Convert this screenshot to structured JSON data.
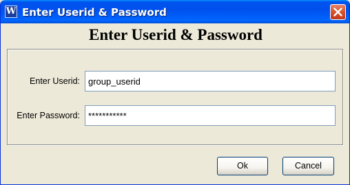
{
  "window": {
    "title": "Enter Userid & Password",
    "icon_letter": "W",
    "icon": "app-logo-icon",
    "close_icon": "close-icon"
  },
  "dialog": {
    "heading": "Enter Userid & Password",
    "fields": [
      {
        "label": "Enter Userid:",
        "value": "group_userid"
      },
      {
        "label": "Enter Password:",
        "value": "***********"
      }
    ],
    "buttons": {
      "ok": "Ok",
      "cancel": "Cancel"
    }
  },
  "colors": {
    "titlebar": "#0054e3",
    "close_button": "#d8552f",
    "dialog_background": "#ece9d8",
    "input_border": "#7f9db9"
  }
}
